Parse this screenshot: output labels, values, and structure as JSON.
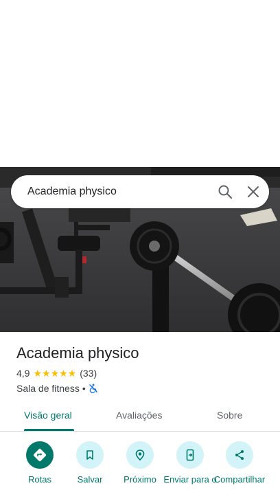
{
  "search": {
    "query": "Academia physico"
  },
  "place": {
    "name": "Academia physico",
    "rating": "4,9",
    "stars": "★★★★★",
    "review_count": "(33)",
    "category": "Sala de fitness",
    "separator": "•"
  },
  "tabs": [
    {
      "label": "Visão geral",
      "active": true
    },
    {
      "label": "Avaliações",
      "active": false
    },
    {
      "label": "Sobre",
      "active": false
    }
  ],
  "actions": [
    {
      "label": "Rotas",
      "icon": "directions-icon"
    },
    {
      "label": "Salvar",
      "icon": "bookmark-icon"
    },
    {
      "label": "Próximo",
      "icon": "nearby-icon"
    },
    {
      "label": "Enviar para o",
      "icon": "send-to-phone-icon"
    },
    {
      "label": "Compartilhar",
      "icon": "share-icon"
    }
  ],
  "colors": {
    "accent": "#00796b",
    "action_bg": "#d2f3f7",
    "star": "#fbbc04",
    "accessibility_icon": "#1a73e8"
  }
}
